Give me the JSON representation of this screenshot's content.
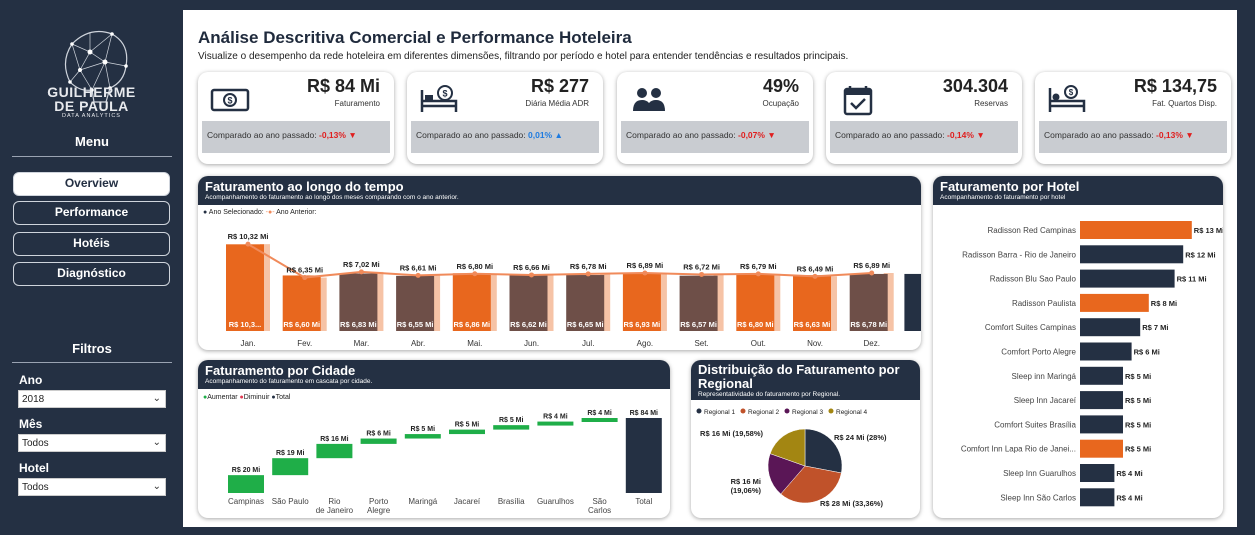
{
  "brand": {
    "line1": "GUILHERME",
    "line2": "DE PAULA",
    "tagline": "DATA ANALYTICS"
  },
  "menu": {
    "title": "Menu",
    "items": [
      {
        "label": "Overview",
        "active": true
      },
      {
        "label": "Performance",
        "active": false
      },
      {
        "label": "Hotéis",
        "active": false
      },
      {
        "label": "Diagnóstico",
        "active": false
      }
    ]
  },
  "filters": {
    "title": "Filtros",
    "ano": {
      "label": "Ano",
      "value": "2018"
    },
    "mes": {
      "label": "Mês",
      "value": "Todos"
    },
    "hotel": {
      "label": "Hotel",
      "value": "Todos"
    }
  },
  "header": {
    "title": "Análise Descritiva Comercial e Performance Hoteleira",
    "subtitle": "Visualize o desempenho da rede hoteleira em diferentes dimensões, filtrando por período e hotel para entender tendências e resultados principais."
  },
  "kpis": [
    {
      "icon": "money-icon",
      "value": "R$ 84 Mi",
      "label": "Faturamento",
      "compare_text": "Comparado ao ano passado:",
      "delta": "-0,13%",
      "arrow": "▼",
      "trend": "neg"
    },
    {
      "icon": "bed-money-icon",
      "value": "R$ 277",
      "label": "Diária Média ADR",
      "compare_text": "Comparado ao ano passado:",
      "delta": "0,01%",
      "arrow": "▲",
      "trend": "pos"
    },
    {
      "icon": "guests-icon",
      "value": "49%",
      "label": "Ocupação",
      "compare_text": "Comparado ao ano passado:",
      "delta": "-0,07%",
      "arrow": "▼",
      "trend": "neg"
    },
    {
      "icon": "calendar-check-icon",
      "value": "304.304",
      "label": "Reservas",
      "compare_text": "Comparado ao ano passado:",
      "delta": "-0,14%",
      "arrow": "▼",
      "trend": "neg"
    },
    {
      "icon": "bed-icon",
      "value": "R$ 134,75",
      "label": "Fat. Quartos Disp.",
      "compare_text": "Comparado ao ano passado:",
      "delta": "-0,13%",
      "arrow": "▼",
      "trend": "neg"
    }
  ],
  "monthly": {
    "title": "Faturamento ao longo do tempo",
    "subtitle": "Acompanhamento do faturamento ao longo dos meses comparando com o ano anterior.",
    "legend": {
      "current": "Ano Selecionado:",
      "previous": "Ano Anterior:"
    },
    "colors": {
      "orange": "#e8671e",
      "brown": "#6e4f48",
      "light": "#f6c3a6",
      "prev_line": "#f08a5a",
      "total": "#243043"
    },
    "chart_data": {
      "type": "bar",
      "categories": [
        "Jan.",
        "Fev.",
        "Mar.",
        "Abr.",
        "Mai.",
        "Jun.",
        "Jul.",
        "Ago.",
        "Set.",
        "Out.",
        "Nov.",
        "Dez."
      ],
      "series": [
        {
          "name": "Ano Selecionado",
          "values": [
            10.3,
            6.6,
            6.83,
            6.55,
            6.86,
            6.62,
            6.65,
            6.93,
            6.57,
            6.8,
            6.63,
            6.78
          ],
          "labels": [
            "R$ 10,3...",
            "R$ 6,60 Mi",
            "R$ 6,83 Mi",
            "R$ 6,55 Mi",
            "R$ 6,86 Mi",
            "R$ 6,62 Mi",
            "R$ 6,65 Mi",
            "R$ 6,93 Mi",
            "R$ 6,57 Mi",
            "R$ 6,80 Mi",
            "R$ 6,63 Mi",
            "R$ 6,78 Mi"
          ]
        },
        {
          "name": "Ano Anterior",
          "values": [
            10.32,
            6.35,
            7.02,
            6.61,
            6.8,
            6.66,
            6.78,
            6.89,
            6.72,
            6.79,
            6.49,
            6.89
          ],
          "labels": [
            "R$ 10,32 Mi",
            "R$ 6,35 Mi",
            "R$ 7,02 Mi",
            "R$ 6,61 Mi",
            "R$ 6,80 Mi",
            "R$ 6,66 Mi",
            "R$ 6,78 Mi",
            "R$ 6,89 Mi",
            "R$ 6,72 Mi",
            "R$ 6,79 Mi",
            "R$ 6,49 Mi",
            "R$ 6,89 Mi"
          ]
        }
      ],
      "bar_colors": [
        "orange",
        "orange",
        "brown",
        "brown",
        "orange",
        "brown",
        "brown",
        "orange",
        "brown",
        "orange",
        "orange",
        "brown"
      ],
      "ylim": [
        0,
        12
      ]
    }
  },
  "hotel": {
    "title": "Faturamento por Hotel",
    "subtitle": "Acompanhamento do faturamento por hotel",
    "chart_data": {
      "type": "bar",
      "orientation": "horizontal",
      "categories": [
        "Radisson Red Campinas",
        "Radisson Barra - Rio de Janeiro",
        "Radisson Blu Sao Paulo",
        "Radisson Paulista",
        "Comfort Suites Campinas",
        "Comfort Porto Alegre",
        "Sleep inn Maringá",
        "Sleep Inn Jacareí",
        "Comfort Suites Brasília",
        "Comfort Inn Lapa Rio de Janei...",
        "Sleep Inn Guarulhos",
        "Sleep Inn São Carlos"
      ],
      "values": [
        13,
        12,
        11,
        8,
        7,
        6,
        5,
        5,
        5,
        5,
        4,
        4
      ],
      "labels": [
        "R$ 13 Mi",
        "R$ 12 Mi",
        "R$ 11 Mi",
        "R$ 8 Mi",
        "R$ 7 Mi",
        "R$ 6 Mi",
        "R$ 5 Mi",
        "R$ 5 Mi",
        "R$ 5 Mi",
        "R$ 5 Mi",
        "R$ 4 Mi",
        "R$ 4 Mi"
      ],
      "highlight": [
        true,
        false,
        false,
        true,
        false,
        false,
        false,
        false,
        false,
        true,
        false,
        false
      ],
      "colors": {
        "highlight": "#e8671e",
        "normal": "#243043"
      }
    }
  },
  "city": {
    "title": "Faturamento por Cidade",
    "subtitle": "Acompanhamento do faturamento em cascata por cidade.",
    "legend": [
      "Aumentar",
      "Diminuir",
      "Total"
    ],
    "legend_colors": [
      "#1fae48",
      "#e03a52",
      "#243043"
    ],
    "chart_data": {
      "type": "bar",
      "subtype": "waterfall",
      "categories": [
        "Campinas",
        "São Paulo",
        "Rio de Janeiro",
        "Porto Alegre",
        "Maringá",
        "Jacareí",
        "Brasília",
        "Guarulhos",
        "São Carlos",
        "Total"
      ],
      "values": [
        20,
        19,
        16,
        6,
        5,
        5,
        5,
        4,
        4,
        84
      ],
      "labels": [
        "R$ 20 Mi",
        "R$ 19 Mi",
        "R$ 16 Mi",
        "R$ 6 Mi",
        "R$ 5 Mi",
        "R$ 5 Mi",
        "R$ 5 Mi",
        "R$ 4 Mi",
        "R$ 4 Mi",
        "R$ 84 Mi"
      ]
    }
  },
  "regional": {
    "title": "Distribuição do Faturamento por Regional",
    "subtitle": "Representatividade do faturamento por Regional.",
    "chart_data": {
      "type": "pie",
      "categories": [
        "Regional 1",
        "Regional 2",
        "Regional 3",
        "Regional 4"
      ],
      "values": [
        28,
        33.36,
        19.06,
        19.58
      ],
      "labels": [
        "R$ 24 Mi (28%)",
        "R$ 28 Mi (33,36%)",
        "R$ 16 Mi (19,06%)",
        "R$ 16 Mi (19,58%)"
      ],
      "colors": [
        "#243043",
        "#c0522a",
        "#5a1656",
        "#a38612"
      ]
    }
  }
}
